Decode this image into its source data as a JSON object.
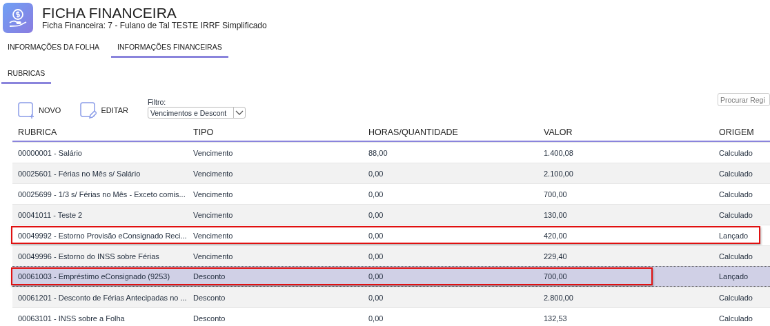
{
  "header": {
    "title": "FICHA FINANCEIRA",
    "subtitle": "Ficha Financeira: 7 - Fulano de Tal TESTE IRRF Simplificado"
  },
  "tabs": [
    {
      "label": "INFORMAÇÕES DA FOLHA",
      "selected": false
    },
    {
      "label": "INFORMAÇÕES FINANCEIRAS",
      "selected": true
    }
  ],
  "subtabs": [
    {
      "label": "RUBRICAS",
      "selected": true
    }
  ],
  "toolbar": {
    "buttons": [
      {
        "kind": "new",
        "label": "NOVO"
      },
      {
        "kind": "edit",
        "label": "EDITAR"
      }
    ],
    "filter": {
      "label": "Filtro:",
      "value": "Vencimentos e Descont"
    },
    "search": {
      "placeholder": "Procurar Regi"
    }
  },
  "table": {
    "columns": [
      "RUBRICA",
      "TIPO",
      "HORAS/QUANTIDADE",
      "VALOR",
      "ORIGEM"
    ],
    "rows": [
      {
        "cells": [
          "00000001 - Salário",
          "Vencimento",
          "88,00",
          "1.400,08",
          "Calculado"
        ],
        "selected": false
      },
      {
        "cells": [
          "00025601 - Férias no Mês s/ Salário",
          "Vencimento",
          "0,00",
          "2.100,00",
          "Calculado"
        ],
        "selected": false
      },
      {
        "cells": [
          "00025699 - 1/3 s/ Férias no Mês - Exceto comis...",
          "Vencimento",
          "0,00",
          "700,00",
          "Calculado"
        ],
        "selected": false
      },
      {
        "cells": [
          "00041011 - Teste 2",
          "Vencimento",
          "0,00",
          "130,00",
          "Calculado"
        ],
        "selected": false
      },
      {
        "cells": [
          "00049992 - Estorno Provisão eConsignado Reci...",
          "Vencimento",
          "0,00",
          "420,00",
          "Lançado"
        ],
        "selected": false,
        "annotated": true
      },
      {
        "cells": [
          "00049996 - Estorno do INSS sobre Férias",
          "Vencimento",
          "0,00",
          "229,40",
          "Calculado"
        ],
        "selected": false
      },
      {
        "cells": [
          "00061003 - Empréstimo eConsignado (9253)",
          "Desconto",
          "0,00",
          "700,00",
          "Lançado"
        ],
        "selected": true,
        "annotated": true
      },
      {
        "cells": [
          "00061201 - Desconto de Férias Antecipadas no ...",
          "Desconto",
          "0,00",
          "2.800,00",
          "Calculado"
        ],
        "selected": false
      },
      {
        "cells": [
          "00063101 - INSS sobre a Folha",
          "Desconto",
          "0,00",
          "132,53",
          "Calculado"
        ],
        "selected": false
      }
    ]
  }
}
